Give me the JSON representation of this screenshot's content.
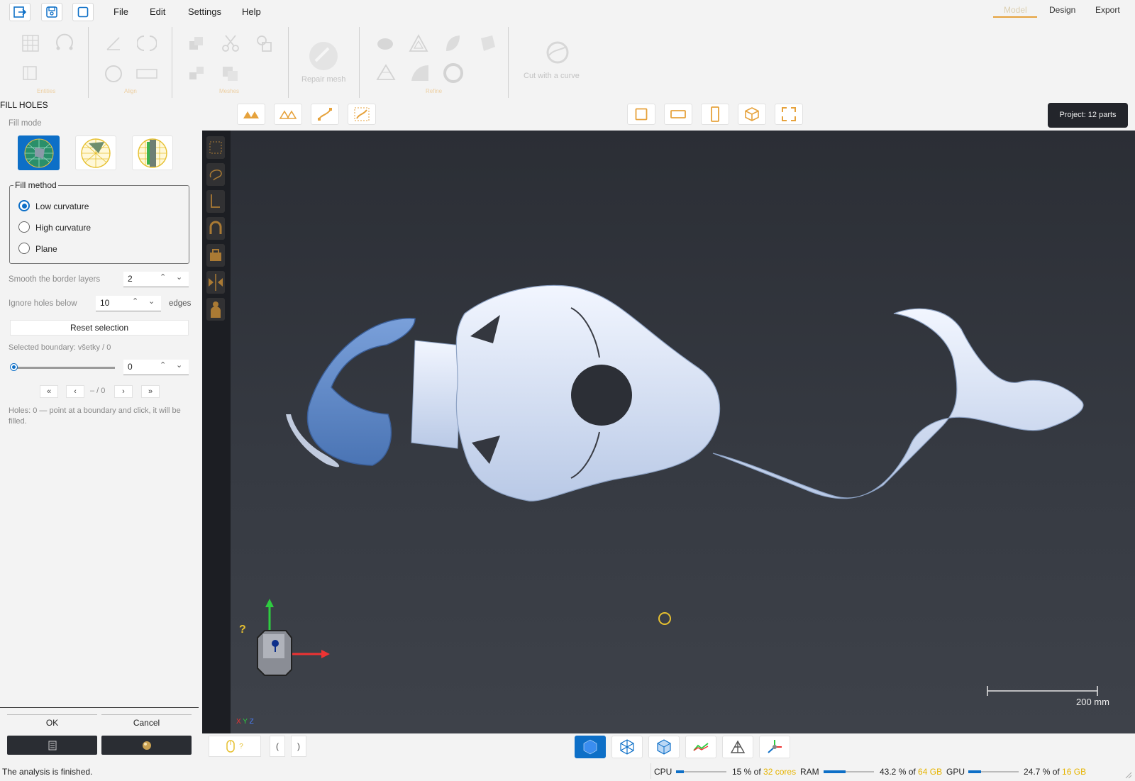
{
  "menu": [
    "File",
    "Edit",
    "Settings",
    "Help"
  ],
  "right_tabs": [
    "Model",
    "Design",
    "Export"
  ],
  "ribbon": {
    "groups": [
      "Entities",
      "Align",
      "Meshes",
      "Refine"
    ],
    "repair_mesh": "Repair mesh",
    "cut_with_curve": "Cut with a curve"
  },
  "project_badge": "Project: 12 parts",
  "panel": {
    "title": "FILL HOLES",
    "fill_mode_label": "Fill mode",
    "fill_method_label": "Fill method",
    "methods": [
      "Low curvature",
      "High curvature",
      "Plane"
    ],
    "selected_method": "Low curvature",
    "smooth_label": "Smooth the border layers",
    "smooth_value": "2",
    "ignore_label": "Ignore holes below",
    "ignore_value": "10",
    "ignore_unit": "edges",
    "reset_label": "Reset selection",
    "selected_boundary": "Selected boundary: všetky / 0",
    "boundary_value": "0",
    "nav": [
      "«",
      "‹",
      "– / 0",
      "›",
      "»"
    ],
    "holes_info": "Holes: 0 — point at a boundary and click, it will be filled.",
    "ok_label": "OK",
    "cancel_label": "Cancel"
  },
  "viewport": {
    "scale_label": "200 mm",
    "axes": {
      "x": "X",
      "y": "Y",
      "z": "Z"
    },
    "help_mark": "?"
  },
  "bottom": {
    "mouse_help": "?",
    "bracket_left": "(",
    "bracket_right": ")"
  },
  "status": {
    "message": "The analysis is finished.",
    "cpu_label": "CPU",
    "cpu_value": "15 % of",
    "cpu_cores": "32 cores",
    "cpu_fraction": 0.15,
    "ram_label": "RAM",
    "ram_value": "43.2 % of",
    "ram_total": "64 GB",
    "ram_fraction": 0.432,
    "gpu_label": "GPU",
    "gpu_value": "24.7 % of",
    "gpu_total": "16 GB",
    "gpu_fraction": 0.247
  },
  "colors": {
    "accent": "#0d6fc7",
    "highlight": "#e6a23c",
    "viewport_bg": "#33363d",
    "part_color": "#dfe8f8",
    "selected_part": "#5b86c6"
  },
  "icons": [
    "exit-icon",
    "save-icon",
    "new-icon",
    "grid-icon",
    "lasso-icon",
    "fill-mode-sphere-icon",
    "fill-mode-wedge-icon",
    "fill-mode-band-icon"
  ]
}
